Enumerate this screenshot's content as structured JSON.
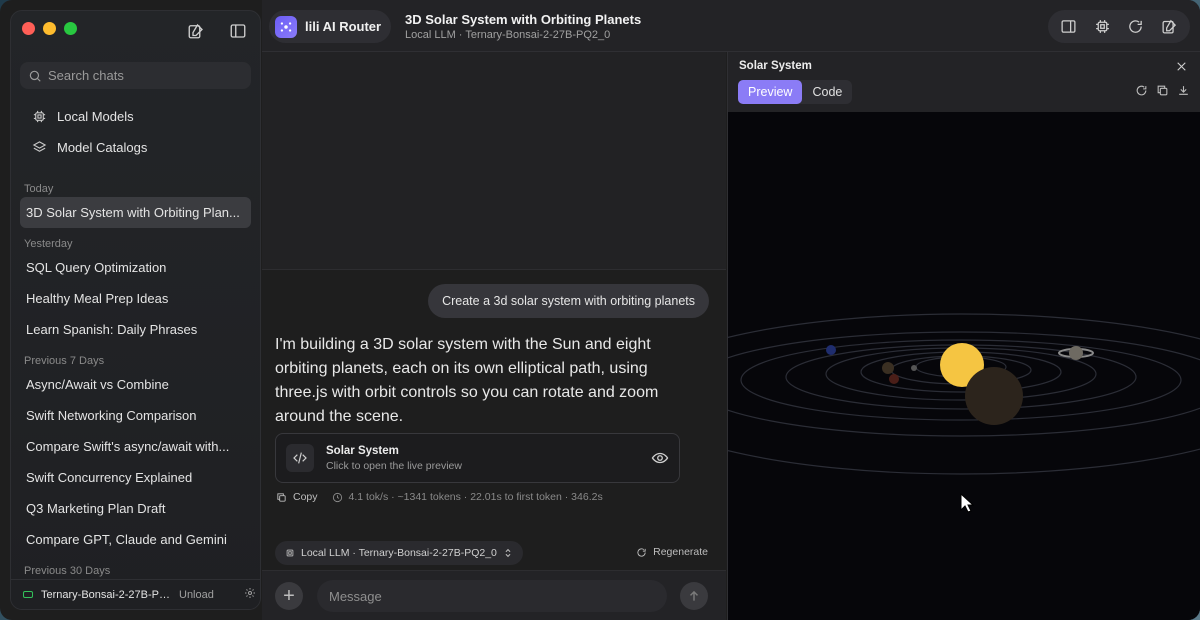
{
  "sidebar": {
    "search_placeholder": "Search chats",
    "nav": [
      {
        "label": "Local Models",
        "icon": "cpu-icon"
      },
      {
        "label": "Model Catalogs",
        "icon": "layers-icon"
      }
    ],
    "sections": [
      {
        "title": "Today",
        "items": [
          "3D Solar System with Orbiting Plan..."
        ]
      },
      {
        "title": "Yesterday",
        "items": [
          "SQL Query Optimization",
          "Healthy Meal Prep Ideas",
          "Learn Spanish: Daily Phrases"
        ]
      },
      {
        "title": "Previous 7 Days",
        "items": [
          "Async/Await vs Combine",
          "Swift Networking Comparison",
          "Compare Swift's async/await with...",
          "Swift Concurrency Explained",
          "Q3 Marketing Plan Draft",
          "Compare GPT, Claude and Gemini"
        ]
      },
      {
        "title": "Previous 30 Days",
        "items": []
      }
    ],
    "footer": {
      "model": "Ternary-Bonsai-2-27B-PQ...",
      "unload": "Unload"
    }
  },
  "topbar": {
    "router_label": "lili AI Router",
    "title": "3D Solar System with Orbiting Planets",
    "subtitle": "Local LLM · Ternary-Bonsai-2-27B-PQ2_0"
  },
  "chat": {
    "user_message": "Create a 3d solar system with orbiting planets",
    "assistant_message": "I'm building a 3D solar system with the Sun and eight orbiting planets, each on its own elliptical path, using three.js with orbit controls so you can rotate and zoom around the scene.",
    "artifact": {
      "title": "Solar System",
      "subtitle": "Click to open the live preview"
    },
    "copy_label": "Copy",
    "stats": "4.1 tok/s · ~1341 tokens · 22.01s to first token · 346.2s",
    "model_chip": "Local LLM · Ternary-Bonsai-2-27B-PQ2_0",
    "regenerate_label": "Regenerate",
    "message_placeholder": "Message"
  },
  "preview": {
    "title": "Solar System",
    "tabs": [
      {
        "label": "Preview",
        "active": true
      },
      {
        "label": "Code",
        "active": false
      }
    ]
  },
  "colors": {
    "accent": "#8b7cf6",
    "sun": "#f5c542"
  }
}
